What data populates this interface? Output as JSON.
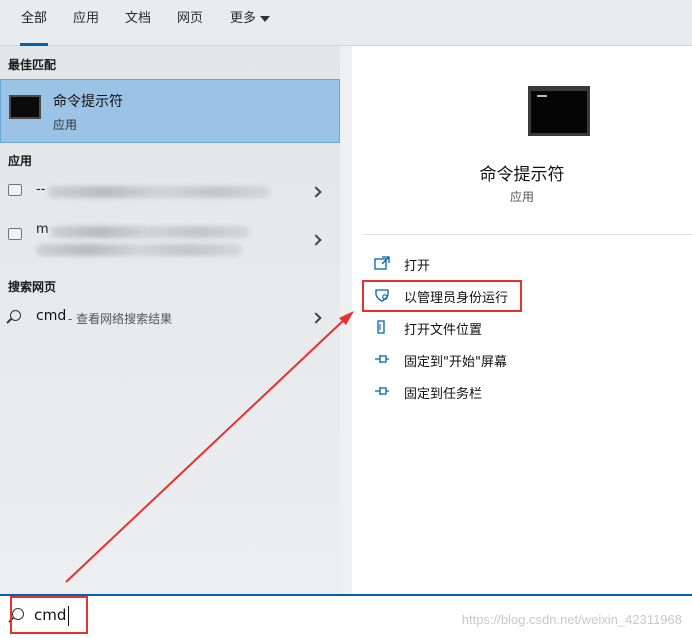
{
  "tabs": [
    {
      "label": "全部"
    },
    {
      "label": "应用"
    },
    {
      "label": "文档"
    },
    {
      "label": "网页"
    },
    {
      "label": "更多"
    }
  ],
  "left": {
    "best_match_header": "最佳匹配",
    "best_match": {
      "name": "命令提示符",
      "type": "应用"
    },
    "apps_header": "应用",
    "apps": [
      {
        "prefix": "--"
      },
      {
        "prefix": "m"
      }
    ],
    "web_header": "搜索网页",
    "web": {
      "query": "cmd",
      "suffix": "- 查看网络搜索结果"
    }
  },
  "right": {
    "title": "命令提示符",
    "subtitle": "应用",
    "actions": [
      {
        "label": "打开",
        "icon": "open-icon"
      },
      {
        "label": "以管理员身份运行",
        "icon": "shield-icon"
      },
      {
        "label": "打开文件位置",
        "icon": "file-location-icon"
      },
      {
        "label": "固定到\"开始\"屏幕",
        "icon": "pin-icon"
      },
      {
        "label": "固定到任务栏",
        "icon": "pin-icon"
      }
    ]
  },
  "search": {
    "value": "cmd"
  },
  "watermark": "https://blog.csdn.net/weixin_42311968",
  "colors": {
    "accent": "#0063b1",
    "selection": "#9ac3e6",
    "annotation": "#e8312f"
  }
}
